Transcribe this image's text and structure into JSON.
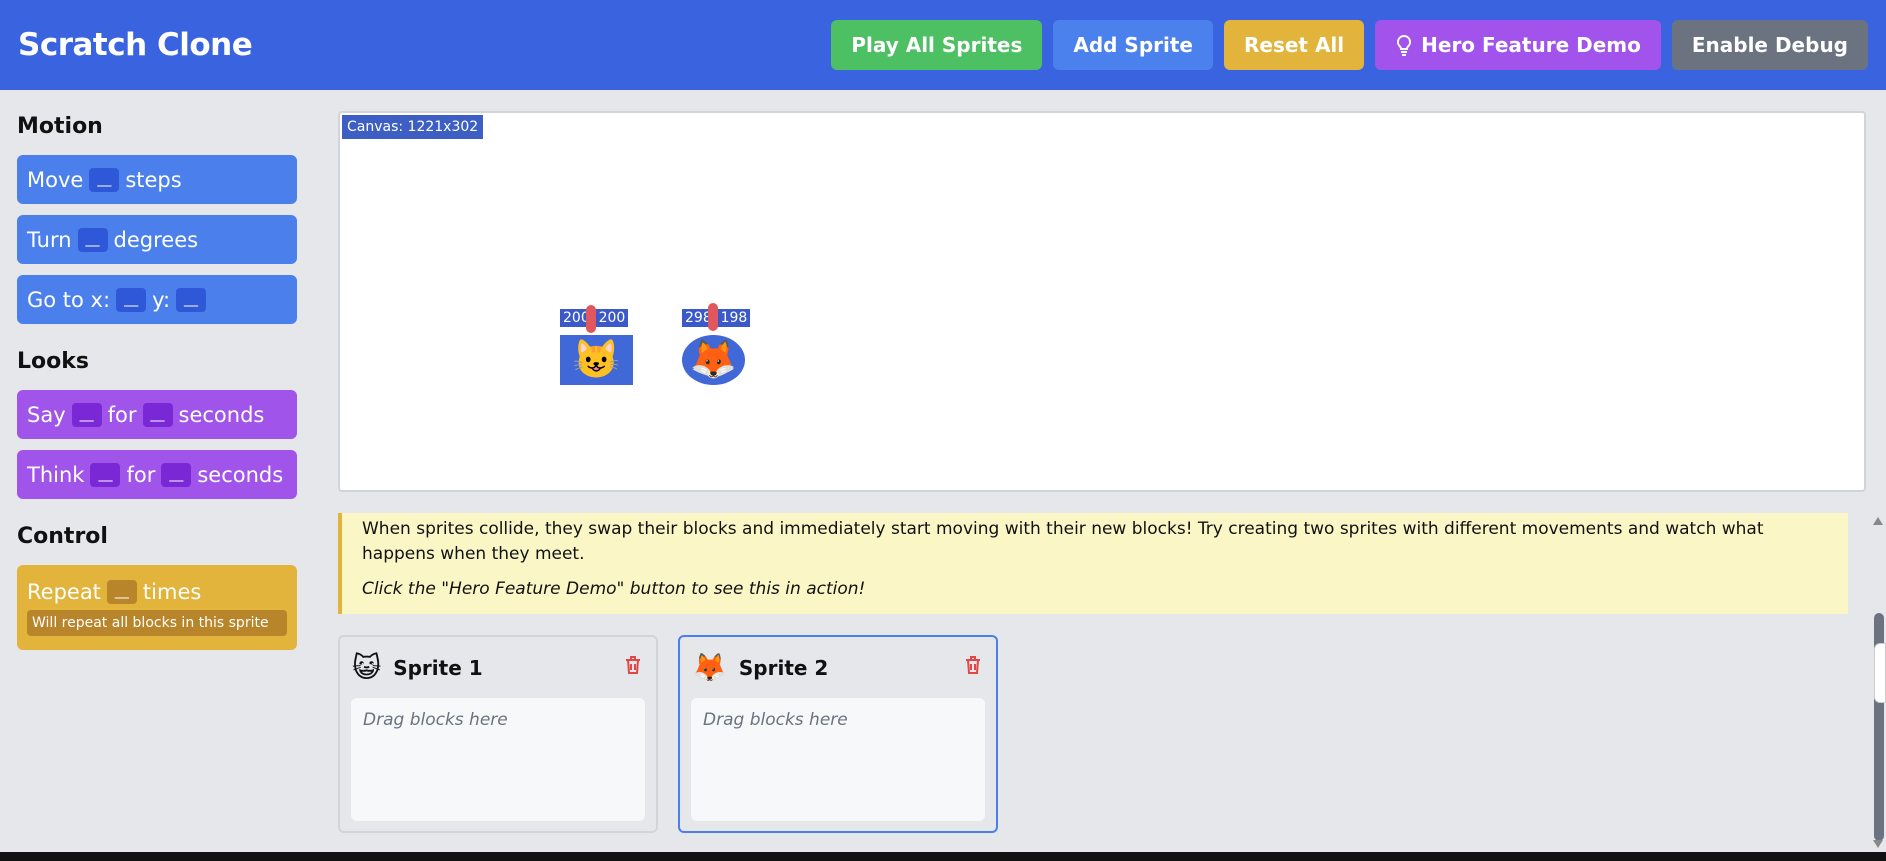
{
  "app": {
    "title": "Scratch Clone"
  },
  "header": {
    "buttons": [
      "Play All Sprites",
      "Add Sprite",
      "Reset All",
      "Hero Feature Demo",
      "Enable Debug"
    ]
  },
  "sidebar": {
    "motion": {
      "title": "Motion",
      "blocks": [
        [
          "Move",
          "steps"
        ],
        [
          "Turn",
          "degrees"
        ],
        [
          "Go to x:",
          "y:"
        ]
      ]
    },
    "looks": {
      "title": "Looks",
      "blocks": [
        [
          "Say",
          "for",
          "seconds"
        ],
        [
          "Think",
          "for",
          "seconds"
        ]
      ]
    },
    "control": {
      "title": "Control",
      "repeat": [
        "Repeat",
        "times"
      ],
      "repeat_note": "Will repeat all blocks in this sprite"
    },
    "slot": "__"
  },
  "canvas": {
    "label": "Canvas: 1221x302",
    "sprites": [
      {
        "coords": "200, 200",
        "emoji": "😺"
      },
      {
        "coords": "298, 198",
        "emoji": "🦊"
      }
    ]
  },
  "notice": {
    "text": "When sprites collide, they swap their blocks and immediately start moving with their new blocks! Try creating two sprites with different movements and watch what happens when they meet.",
    "emphasis": "Click the \"Hero Feature Demo\" button to see this in action!"
  },
  "sprites": [
    {
      "name": "Sprite 1",
      "emoji": "😺",
      "placeholder": "Drag blocks here"
    },
    {
      "name": "Sprite 2",
      "emoji": "🦊",
      "placeholder": "Drag blocks here"
    }
  ],
  "colors": {
    "header": "#3a63e0",
    "motion": "#4b80ec",
    "looks": "#a154ea",
    "control": "#e3b43c"
  }
}
